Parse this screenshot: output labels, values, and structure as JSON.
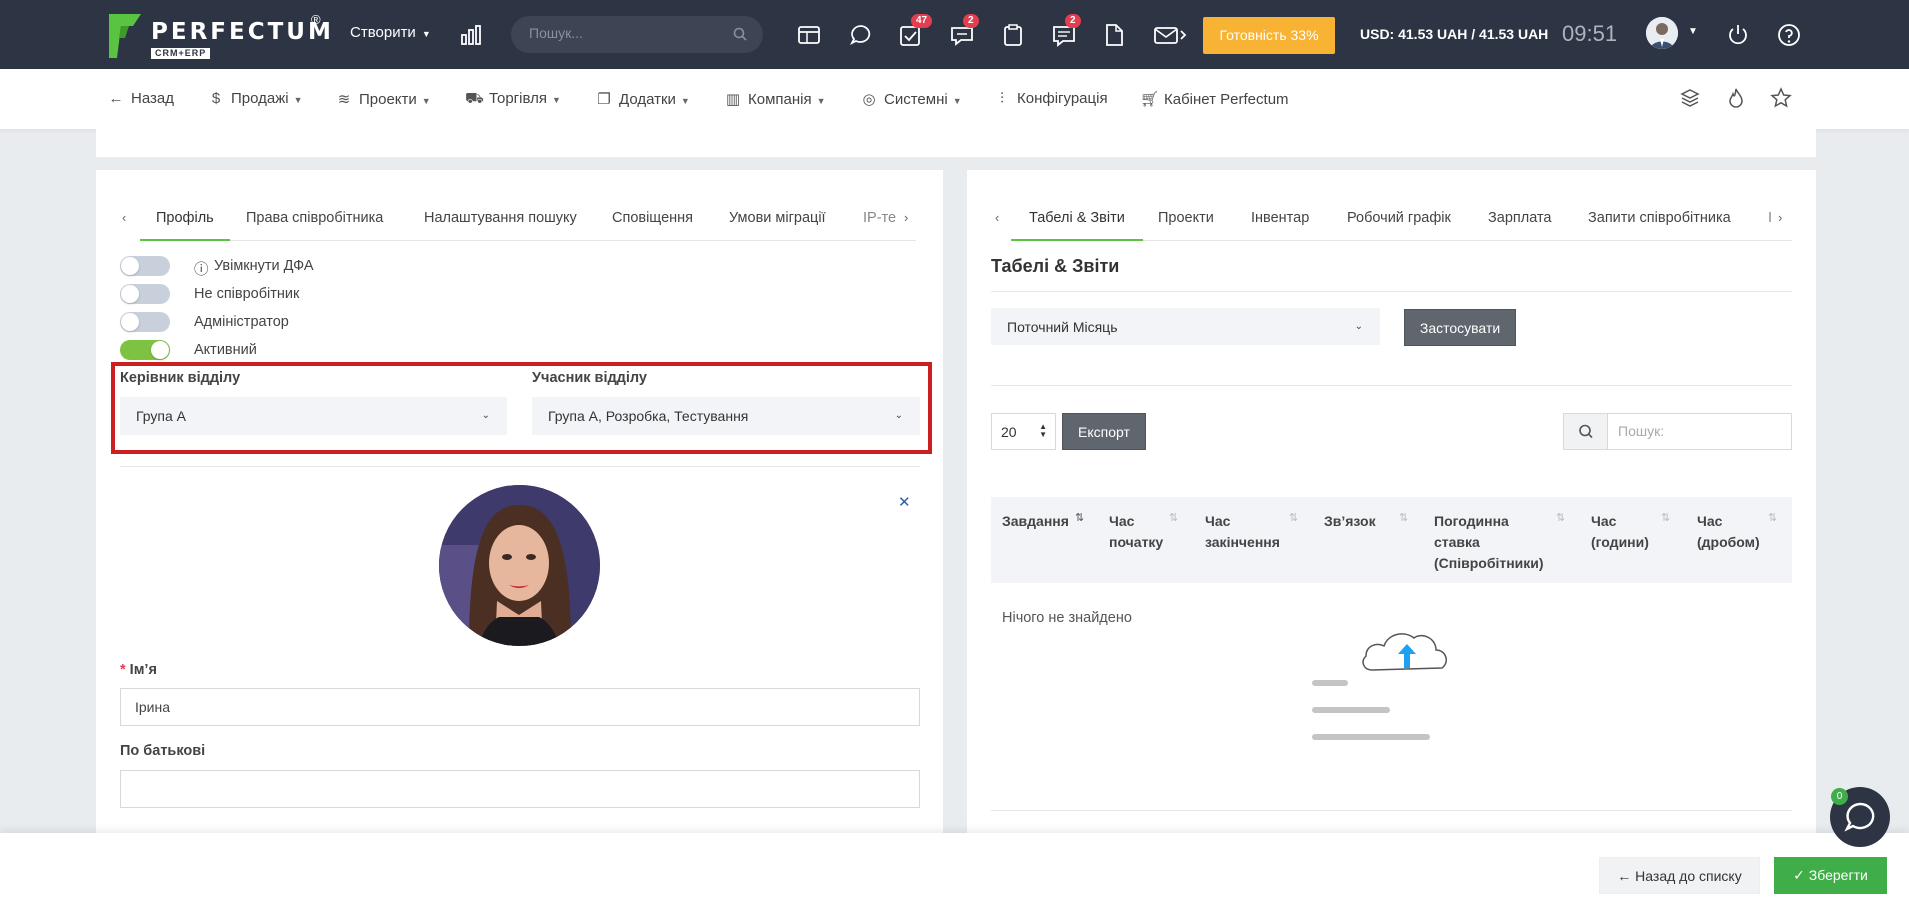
{
  "topbar": {
    "logo_word": "PERFECTUM",
    "logo_reg": "®",
    "logo_sub": "CRM+ERP",
    "create_label": "Створити",
    "search_placeholder": "Пошук...",
    "badges": {
      "tasks": "47",
      "chat": "2",
      "notes": "2"
    },
    "readiness_label": "Готовність 33%",
    "rates": "USD: 41.53 UAH / 41.53 UAH",
    "time": "09:51"
  },
  "nav": {
    "back": "Назад",
    "sales": "Продажі",
    "projects": "Проекти",
    "trade": "Торгівля",
    "addons": "Додатки",
    "company": "Компанія",
    "system": "Системні",
    "config": "Конфігурація",
    "cabinet": "Кабінет Perfectum"
  },
  "left": {
    "tabs": [
      "Профіль",
      "Права співробітника",
      "Налаштування пошуку",
      "Сповіщення",
      "Умови міграції",
      "IP-те"
    ],
    "toggles": [
      {
        "label": "Увімкнути ДФА",
        "on": false
      },
      {
        "label": "Не співробітник",
        "on": false
      },
      {
        "label": "Адміністратор",
        "on": false
      },
      {
        "label": "Активний",
        "on": true
      }
    ],
    "dept_head_label": "Керівник відділу",
    "dept_head_value": "Група А",
    "dept_member_label": "Учасник відділу",
    "dept_member_value": "Група А, Розробка, Тестування",
    "first_name_label": "Ім’я",
    "first_name_value": "Ірина",
    "patronymic_label": "По батькові",
    "patronymic_value": ""
  },
  "right": {
    "tabs": [
      "Табелі & Звіти",
      "Проекти",
      "Інвентар",
      "Робочий графік",
      "Зарплата",
      "Запити співробітника",
      "І"
    ],
    "section_title": "Табелі & Звіти",
    "period_value": "Поточний Місяць",
    "apply_label": "Застосувати",
    "page_size": "20",
    "export_label": "Експорт",
    "search_placeholder": "Пошук:",
    "columns": [
      "Завдання",
      "Час початку",
      "Час закінчення",
      "Зв’язок",
      "Погодинна ставка (Співробітники)",
      "Час (години)",
      "Час (дробом)"
    ],
    "empty_text": "Нічого не знайдено"
  },
  "bottom": {
    "back_to_list": "Назад до списку",
    "save": "Зберегти",
    "chat_count": "0"
  },
  "colors": {
    "topbar_bg": "#2d3443",
    "accent_green": "#5ac341",
    "readiness_bg": "#f8b334",
    "highlight_red": "#cc1f1f",
    "save_green": "#3fae49"
  }
}
